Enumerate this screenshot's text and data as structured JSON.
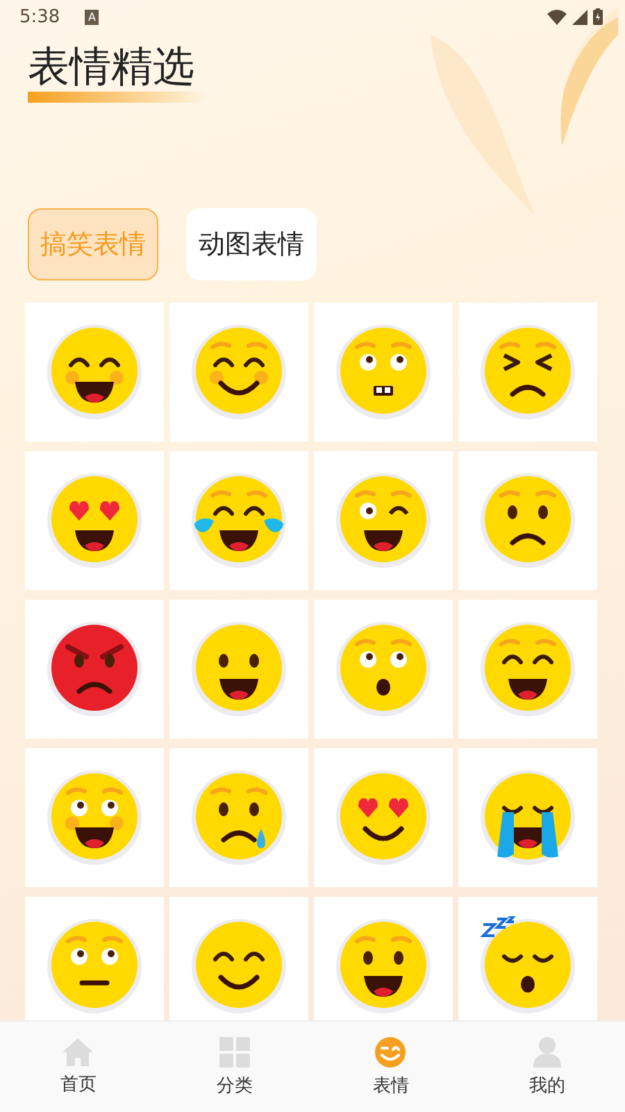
{
  "status_bar": {
    "time": "5:38",
    "notification": "A"
  },
  "title": "表情精选",
  "tabs": [
    {
      "label": "搞笑表情",
      "selected": true
    },
    {
      "label": "动图表情",
      "selected": false
    }
  ],
  "stickers": [
    {
      "kind": "laugh"
    },
    {
      "kind": "smile"
    },
    {
      "kind": "nervous"
    },
    {
      "kind": "squint"
    },
    {
      "kind": "hearts"
    },
    {
      "kind": "tears"
    },
    {
      "kind": "wink"
    },
    {
      "kind": "sad"
    },
    {
      "kind": "angry"
    },
    {
      "kind": "happy"
    },
    {
      "kind": "surprised"
    },
    {
      "kind": "beam"
    },
    {
      "kind": "scared"
    },
    {
      "kind": "worried"
    },
    {
      "kind": "loving"
    },
    {
      "kind": "crying"
    },
    {
      "kind": "neutral"
    },
    {
      "kind": "content"
    },
    {
      "kind": "grinning"
    },
    {
      "kind": "sleepy"
    }
  ],
  "bottom_nav": [
    {
      "label": "首页",
      "kind": "home",
      "selected": false
    },
    {
      "label": "分类",
      "kind": "grid",
      "selected": false
    },
    {
      "label": "表情",
      "kind": "smiley",
      "selected": true
    },
    {
      "label": "我的",
      "kind": "person",
      "selected": false
    }
  ]
}
